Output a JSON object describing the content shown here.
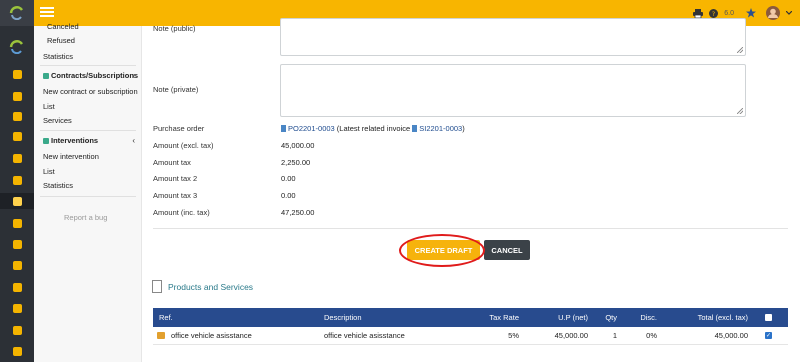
{
  "topbar": {
    "version": "6.0"
  },
  "menu": {
    "items_top": [
      "Canceled",
      "Refused",
      "Statistics"
    ],
    "contracts": {
      "title": "Contracts/Subscriptions",
      "items": [
        "New contract or subscription",
        "List",
        "Services"
      ]
    },
    "interventions": {
      "title": "Interventions",
      "items": [
        "New intervention",
        "List",
        "Statistics"
      ]
    },
    "report_bug": "Report a bug"
  },
  "form": {
    "note_public_label": "Note (public)",
    "note_private_label": "Note (private)",
    "purchase_order_label": "Purchase order",
    "purchase_order_ref": "PO2201-0003",
    "purchase_order_mid": " (Latest related invoice ",
    "invoice_ref": "SI2201-0003",
    "purchase_order_end": ")",
    "amount_excl_label": "Amount (excl. tax)",
    "amount_excl": "45,000.00",
    "amount_tax_label": "Amount tax",
    "amount_tax": "2,250.00",
    "amount_tax2_label": "Amount tax 2",
    "amount_tax2": "0.00",
    "amount_tax3_label": "Amount tax 3",
    "amount_tax3": "0.00",
    "amount_inc_label": "Amount (inc. tax)",
    "amount_inc": "47,250.00"
  },
  "buttons": {
    "create_draft": "CREATE DRAFT",
    "cancel": "CANCEL"
  },
  "products": {
    "title": "Products and Services",
    "headers": {
      "ref": "Ref.",
      "description": "Description",
      "tax_rate": "Tax Rate",
      "up": "U.P (net)",
      "qty": "Qty",
      "disc": "Disc.",
      "total": "Total (excl. tax)"
    },
    "rows": [
      {
        "ref": "office vehicle asisstance",
        "description": "office vehicle asisstance",
        "tax_rate": "5%",
        "up": "45,000.00",
        "qty": "1",
        "disc": "0%",
        "total": "45,000.00"
      }
    ]
  },
  "colors": {
    "topbar": "#f8b500",
    "table_header": "#284b8e",
    "highlight": "#e01b1b"
  }
}
